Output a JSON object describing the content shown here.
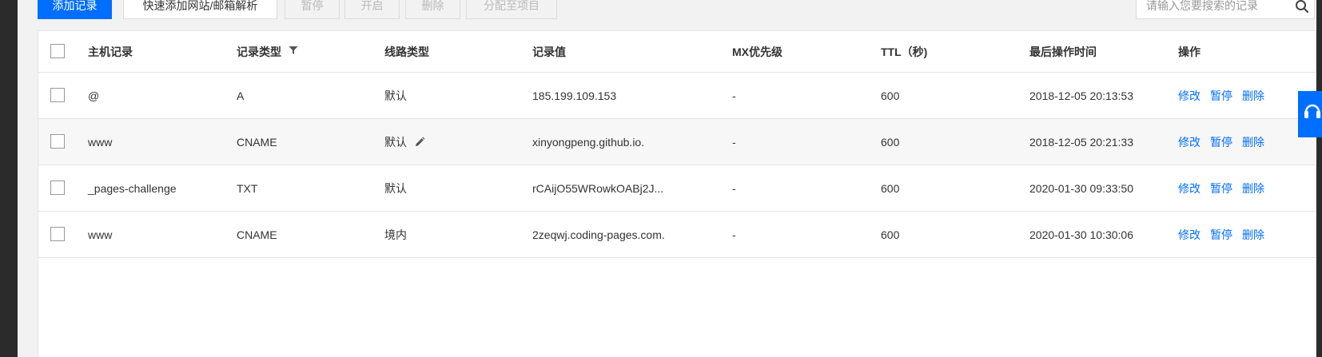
{
  "toolbar": {
    "add_record": "添加记录",
    "quick_add": "快速添加网站/邮箱解析",
    "pause": "暂停",
    "enable": "开启",
    "delete": "删除",
    "assign_project": "分配至项目"
  },
  "search": {
    "placeholder": "请输入您要搜索的记录"
  },
  "table": {
    "headers": {
      "host": "主机记录",
      "type": "记录类型",
      "line": "线路类型",
      "value": "记录值",
      "mx": "MX优先级",
      "ttl": "TTL（秒)",
      "time": "最后操作时间",
      "ops": "操作"
    },
    "rows": [
      {
        "host": "@",
        "type": "A",
        "line": "默认",
        "value": "185.199.109.153",
        "mx": "-",
        "ttl": "600",
        "time": "2018-12-05 20:13:53"
      },
      {
        "host": "www",
        "type": "CNAME",
        "line": "默认",
        "value": "xinyongpeng.github.io.",
        "mx": "-",
        "ttl": "600",
        "time": "2018-12-05 20:21:33"
      },
      {
        "host": "_pages-challenge",
        "type": "TXT",
        "line": "默认",
        "value": "rCAijO55WRowkOABj2J...",
        "mx": "-",
        "ttl": "600",
        "time": "2020-01-30 09:33:50"
      },
      {
        "host": "www",
        "type": "CNAME",
        "line": "境内",
        "value": "2zeqwj.coding-pages.com.",
        "mx": "-",
        "ttl": "600",
        "time": "2020-01-30 10:30:06"
      }
    ],
    "actions": {
      "edit": "修改",
      "pause": "暂停",
      "delete": "删除"
    }
  },
  "colors": {
    "accent": "#006eff",
    "border": "#e5e5e5",
    "alt_row": "#f7f7f7"
  },
  "icons": [
    "filter-icon",
    "pencil-icon",
    "search-icon",
    "support-icon"
  ]
}
